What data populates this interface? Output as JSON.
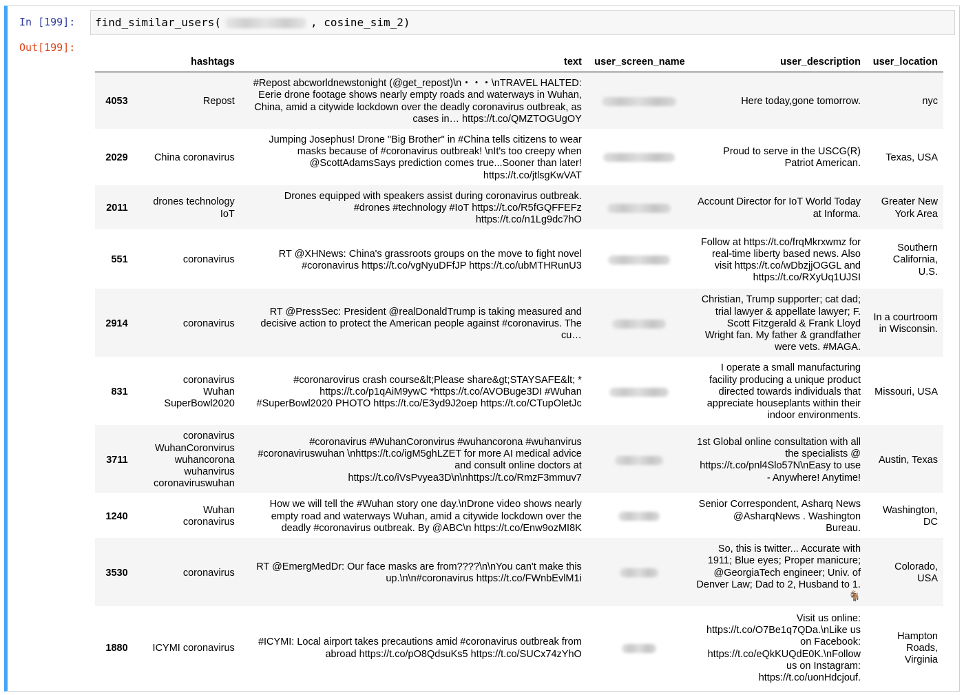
{
  "cell": {
    "in_prompt": "In [199]:",
    "out_prompt": "Out[199]:",
    "code_prefix": "find_similar_users(",
    "code_suffix": ", cosine_sim_2)"
  },
  "table": {
    "columns": [
      "",
      "hashtags",
      "text",
      "user_screen_name",
      "user_description",
      "user_location"
    ],
    "rows": [
      {
        "index": "4053",
        "hashtags": [
          "Repost"
        ],
        "text": "#Repost abcworldnewstonight (@get_repost)\\n・・・\\nTRAVEL HALTED: Eerie drone footage shows nearly empty roads and waterways in Wuhan, China, amid a citywide lockdown over the deadly coronavirus outbreak, as cases in… https://t.co/QMZTOGUgOY",
        "user_description": "Here today,gone tomorrow.",
        "user_location": "nyc"
      },
      {
        "index": "2029",
        "hashtags": [
          "China coronavirus"
        ],
        "text": "Jumping Josephus! Drone \"Big Brother\" in #China tells citizens to wear masks because of #coronavirus outbreak! \\nIt's too creepy when @ScottAdamsSays prediction comes true...Sooner than later! https://t.co/jtlsgKwVAT",
        "user_description": "Proud to serve in the USCG(R) Patriot American.",
        "user_location": "Texas, USA"
      },
      {
        "index": "2011",
        "hashtags": [
          "drones technology",
          "IoT"
        ],
        "text": "Drones equipped with speakers assist during coronavirus outbreak. #drones #technology #IoT https://t.co/R5fGQFFEFz https://t.co/n1Lg9dc7hO",
        "user_description": "Account Director for IoT World Today at Informa.",
        "user_location": "Greater New York Area"
      },
      {
        "index": "551",
        "hashtags": [
          "coronavirus"
        ],
        "text": "RT @XHNews: China's grassroots groups on the move to fight novel #coronavirus https://t.co/vgNyuDFfJP https://t.co/ubMTHRunU3",
        "user_description": "Follow at https://t.co/frqMkrxwmz for real-time liberty based news. Also visit https://t.co/wDbzjjOGGL and https://t.co/RXyUq1UJSI",
        "user_location": "Southern California, U.S."
      },
      {
        "index": "2914",
        "hashtags": [
          "coronavirus"
        ],
        "text": "RT @PressSec: President @realDonaldTrump is taking measured and decisive action to protect the American people against #coronavirus. The cu…",
        "user_description": "Christian, Trump supporter; cat dad; trial lawyer & appellate lawyer; F. Scott Fitzgerald & Frank Lloyd Wright fan. My father & grandfather were vets. #MAGA.",
        "user_location": "In a courtroom in Wisconsin."
      },
      {
        "index": "831",
        "hashtags": [
          "coronavirus",
          "Wuhan",
          "SuperBowl2020"
        ],
        "text": "#coronarovirus crash course&lt;Please share&gt;STAYSAFE&lt; * https://t.co/p1qAiM9ywC *https://t.co/AVOBuge3DI #Wuhan #SuperBowl2020 PHOTO https://t.co/E3yd9J2oep https://t.co/CTupOletJc",
        "user_description": "I operate a small manufacturing facility producing a unique product directed towards individuals that appreciate houseplants within their indoor environments.",
        "user_location": "Missouri, USA"
      },
      {
        "index": "3711",
        "hashtags": [
          "coronavirus",
          "WuhanCoronvirus",
          "wuhancorona",
          "wuhanvirus",
          "coronaviruswuhan"
        ],
        "text": "#coronavirus #WuhanCoronvirus #wuhancorona #wuhanvirus #coronaviruswuhan \\nhttps://t.co/igM5ghLZET for more AI medical advice and consult online doctors at https://t.co/iVsPvyea3D\\n\\nhttps://t.co/RmzF3mmuv7",
        "user_description": "1st Global online consultation with all the specialists @ https://t.co/pnl4Slo57N\\nEasy to use - Anywhere! Anytime!",
        "user_location": "Austin, Texas"
      },
      {
        "index": "1240",
        "hashtags": [
          "Wuhan",
          "coronavirus"
        ],
        "text": "How we will tell the #Wuhan story one day.\\nDrone video shows nearly empty road and waterways Wuhan, amid a citywide lockdown over the deadly #coronavirus outbreak. By @ABC\\n https://t.co/Enw9ozMI8K",
        "user_description": "Senior Correspondent, Asharq News @AsharqNews . Washington Bureau.",
        "user_location": "Washington, DC"
      },
      {
        "index": "3530",
        "hashtags": [
          "coronavirus"
        ],
        "text": "RT @EmergMedDr: Our face masks are from????\\n\\nYou can't make this up.\\n\\n#coronavirus https://t.co/FWnbEvlM1i",
        "user_description": "So, this is twitter... Accurate with 1911; Blue eyes; Proper manicure; @GeorgiaTech engineer; Univ. of Denver Law; Dad to 2, Husband to 1. 🐐",
        "user_location": "Colorado, USA"
      },
      {
        "index": "1880",
        "hashtags": [
          "ICYMI coronavirus"
        ],
        "text": "#ICYMI: Local airport takes precautions amid #coronavirus outbreak from abroad https://t.co/pO8QdsuKs5 https://t.co/SUCx74zYhO",
        "user_description": "Visit us online: https://t.co/O7Be1q7QDa.\\nLike us on Facebook: https://t.co/eQkKUQdE0K.\\nFollow us on Instagram: https://t.co/uonHdcjouf.",
        "user_location": "Hampton Roads, Virginia"
      }
    ]
  }
}
